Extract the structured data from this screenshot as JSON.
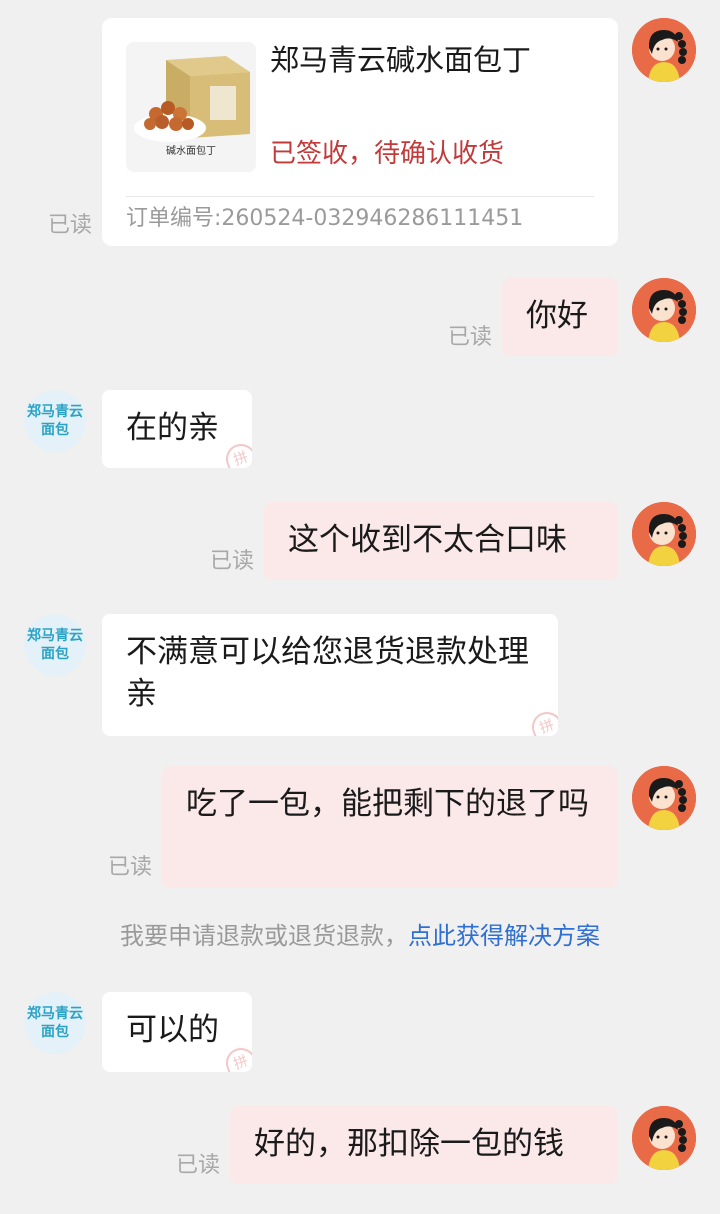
{
  "order_card": {
    "product_title": "郑马青云碱水面包丁",
    "status": "已签收，待确认收货",
    "order_number": "订单编号:260524-032946286111451",
    "product_image_caption": "碱水面包丁",
    "read_label": "已读"
  },
  "shop": {
    "avatar_line1": "郑马青云",
    "avatar_line2": "面包"
  },
  "messages": [
    {
      "sender": "me",
      "text": "你好",
      "read": "已读"
    },
    {
      "sender": "shop",
      "text": "在的亲"
    },
    {
      "sender": "me",
      "text": "这个收到不太合口味",
      "read": "已读"
    },
    {
      "sender": "shop",
      "text": "不满意可以给您退货退款处理亲"
    },
    {
      "sender": "me",
      "text": "吃了一包，能把剩下的退了吗",
      "read": "已读"
    },
    {
      "sender": "shop",
      "text": "可以的"
    },
    {
      "sender": "me",
      "text": "好的，那扣除一包的钱",
      "read": "已读"
    }
  ],
  "system_note": {
    "text": "我要申请退款或退货退款，",
    "link": "点此获得解决方案"
  },
  "stamp_glyph": "拼",
  "colors": {
    "background": "#f0f0f0",
    "my_bubble": "#fbe9e9",
    "shop_bubble": "#ffffff",
    "status_red": "#c23a3a",
    "link_blue": "#2f6fd1",
    "shop_avatar_text": "#2aa3c6",
    "user_avatar_bg": "#e86a47"
  },
  "icons": [
    "user-avatar-icon",
    "shop-avatar-icon",
    "product-thumbnail-icon",
    "pinduoduo-stamp-icon"
  ]
}
